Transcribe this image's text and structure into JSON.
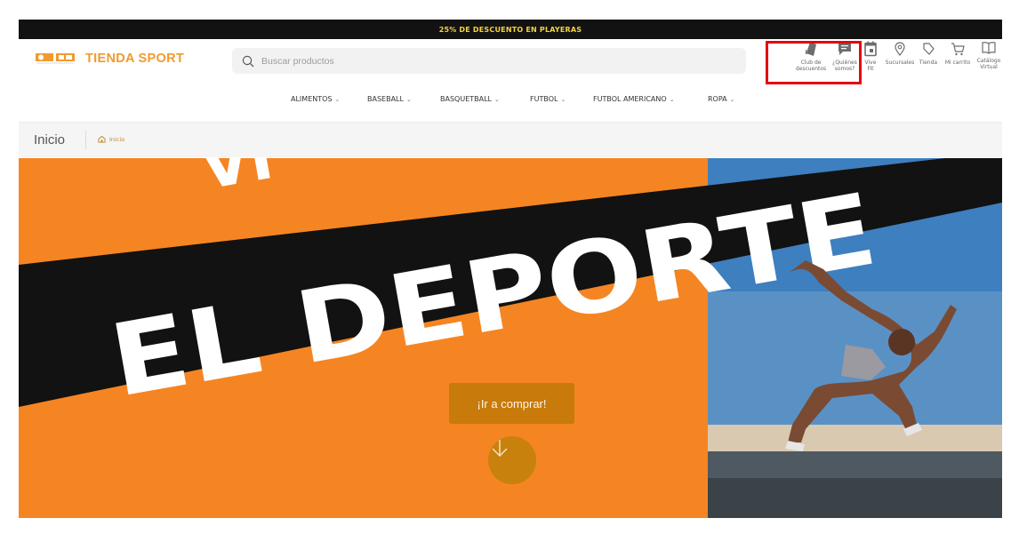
{
  "promo": {
    "text": "25% DE DESCUENTO EN PLAYERAS"
  },
  "header": {
    "brand": "TIENDA SPORT",
    "search": {
      "placeholder": "Buscar productos",
      "value": ""
    },
    "nav_icons": [
      {
        "label": "Club de descuentos",
        "icon": "tag-stack-icon"
      },
      {
        "label": "¿Quiénes somos?",
        "icon": "chat-icon"
      },
      {
        "label": "Vive Fit",
        "icon": "calendar-icon"
      },
      {
        "label": "Sucursales",
        "icon": "location-pin-icon"
      },
      {
        "label": "Tienda",
        "icon": "tag-icon"
      },
      {
        "label": "Mi carrito",
        "icon": "cart-icon"
      },
      {
        "label": "Catálogo Virtual",
        "icon": "book-icon"
      }
    ]
  },
  "categories": [
    {
      "label": "ALIMENTOS"
    },
    {
      "label": "BASEBALL"
    },
    {
      "label": "BASQUETBALL"
    },
    {
      "label": "FUTBOL"
    },
    {
      "label": "FUTBOL AMERICANO"
    },
    {
      "label": "ROPA"
    }
  ],
  "breadcrumb": {
    "title": "Inicio",
    "link": "Inicio"
  },
  "hero": {
    "headline": "EL DEPORTE",
    "cta": "¡Ir a comprar!"
  },
  "colors": {
    "accent": "#f29a2e",
    "hero_orange": "#f58522",
    "cta": "#c87a0b",
    "promo_bg": "#121212",
    "promo_text": "#f5d33f",
    "highlight": "#e30613"
  }
}
